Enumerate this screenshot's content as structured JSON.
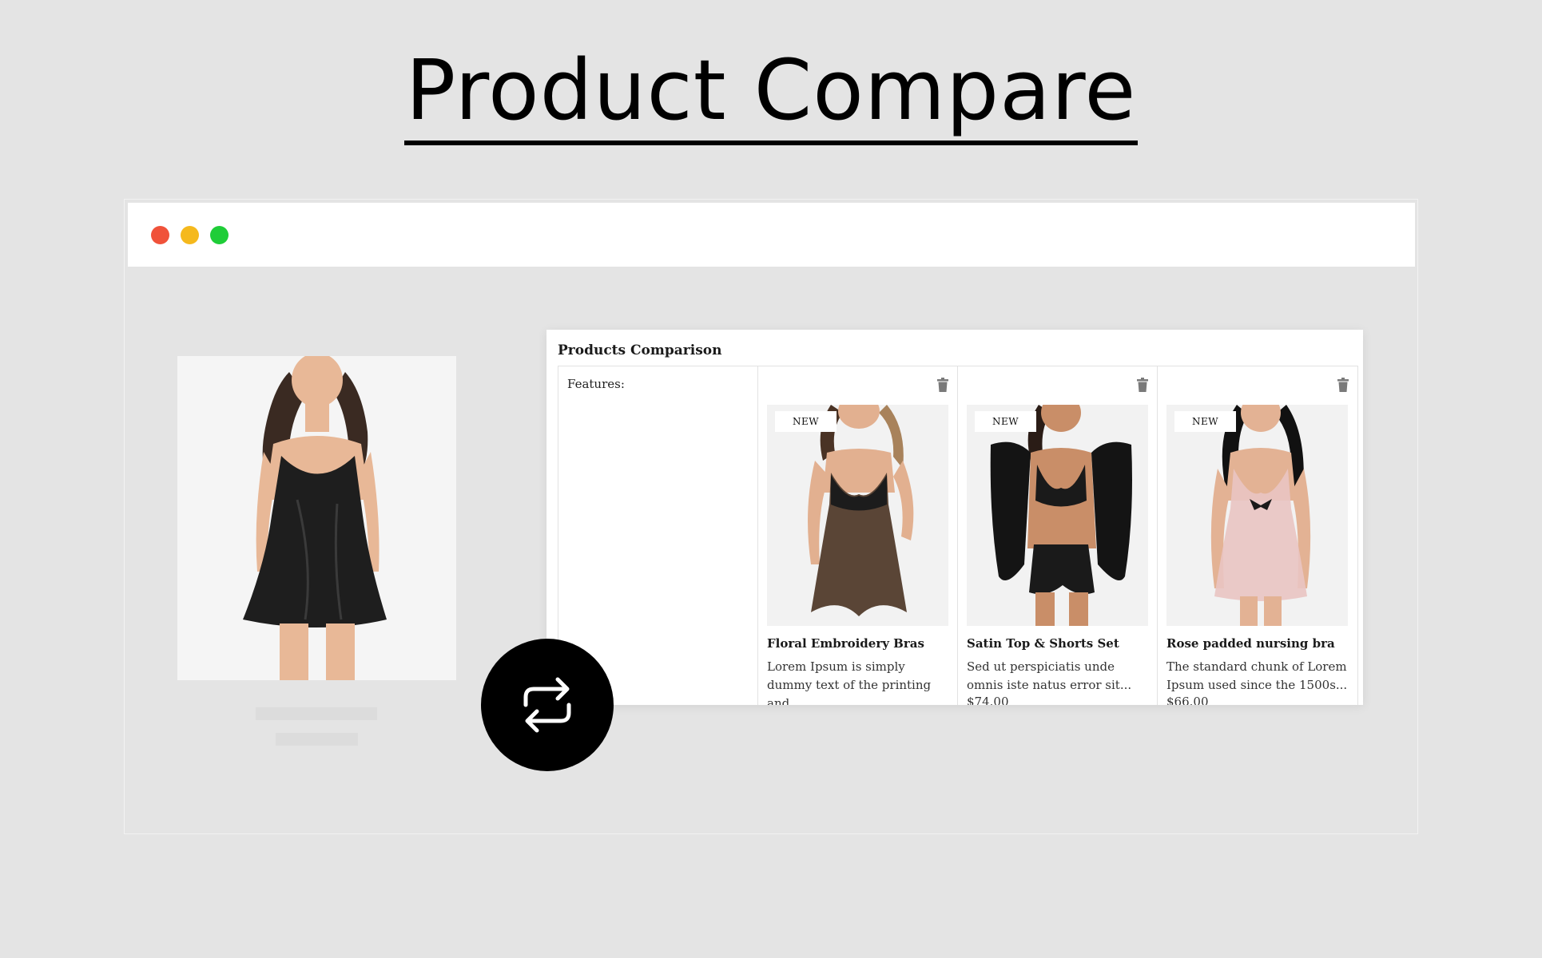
{
  "hero": {
    "title": "Product Compare"
  },
  "window": {
    "controls": [
      "close",
      "minimize",
      "maximize"
    ]
  },
  "panel": {
    "title": "Products Comparison",
    "features_label": "Features:",
    "products": [
      {
        "badge": "NEW",
        "name": "Floral Embroidery Bras",
        "description": "Lorem Ipsum is simply dummy text of the printing and...",
        "price": ""
      },
      {
        "badge": "NEW",
        "name": "Satin Top & Shorts Set",
        "description": "Sed ut perspiciatis unde omnis iste natus error sit...",
        "price": "$74.00"
      },
      {
        "badge": "NEW",
        "name": "Rose padded nursing bra",
        "description": "The standard chunk of Lorem Ipsum used since the 1500s...",
        "price": "$66.00"
      }
    ]
  },
  "colors": {
    "background": "#e4e4e4",
    "close": "#f0523a",
    "minimize": "#f5b91d",
    "maximize": "#1fcd38",
    "compare_button": "#000000"
  },
  "icons": [
    "trash-icon",
    "compare-arrows-icon"
  ]
}
